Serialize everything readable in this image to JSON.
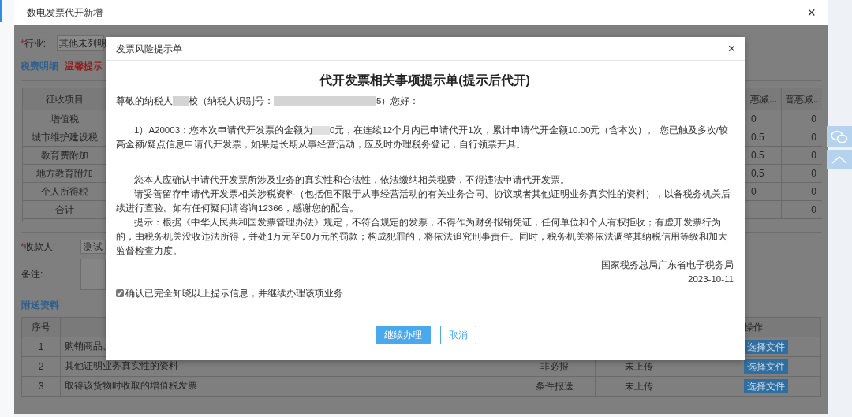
{
  "window": {
    "title": "数电发票代开新增",
    "close": "×"
  },
  "industry": {
    "required_mark": "*",
    "label": "行业:",
    "value": "其他未列明"
  },
  "links": [
    {
      "label": "税费明细",
      "kind": "link"
    },
    {
      "label": "温馨提示",
      "kind": "warning"
    }
  ],
  "tax_table": {
    "column_1": "征收项目",
    "column_a": "惠减...",
    "column_b": "普惠减...",
    "rows": [
      {
        "item": "增值税",
        "column_a": "0",
        "column_b": "0"
      },
      {
        "item": "城市维护建设税",
        "column_a": "0.5",
        "column_b": "0"
      },
      {
        "item": "教育费附加",
        "column_a": "0.5",
        "column_b": "0"
      },
      {
        "item": "地方教育附加",
        "column_a": "0.5",
        "column_b": "0"
      },
      {
        "item": "个人所得税",
        "column_a": "0",
        "column_b": "0"
      },
      {
        "item": "合计",
        "column_b": "0"
      }
    ]
  },
  "payee": {
    "required_mark": "*",
    "label": "收款人:",
    "value": "测试"
  },
  "remark": {
    "label": "备注:"
  },
  "attachments": {
    "title": "附送资料",
    "columns": {
      "number": "序号",
      "action": "操作"
    },
    "rows": [
      {
        "number": "1",
        "name": "购销商品、",
        "button": "选择文件"
      },
      {
        "number": "2",
        "name": "其他证明业务真实性的资料",
        "requirement": "非必报",
        "status": "未上传",
        "button": "选择文件"
      },
      {
        "number": "3",
        "name": "取得该货物时收取的增值税发票",
        "requirement": "条件报送",
        "status": "未上传",
        "button": "选择文件"
      }
    ]
  },
  "dialog": {
    "title": "发票风险提示单",
    "close": "×",
    "heading": "代开发票相关事项提示单(提示后代开)",
    "greeting": [
      "尊敬的纳税人",
      "校（纳税人识别号：",
      "5）您好："
    ],
    "notice": [
      "1）A20003：您本次申请代开发票的金额为",
      "0元，在连续12个月内已申请代开1次，累计申请代开金额10.00元（含本次）。 您已触及多次/较高金额/疑点信息申请代开发票，如果是长期从事经营活动，应及时办理税务登记，自行领票开具。"
    ],
    "paragraphs": [
      "您本人应确认申请代开发票所涉及业务的真实性和合法性，依法缴纳相关税费，不得违法申请代开发票。",
      "请妥善留存申请代开发票相关涉税资料（包括但不限于从事经营活动的有关业务合同、协议或者其他证明业务真实性的资料），以备税务机关后续进行查验。如有任何疑问请咨询12366，感谢您的配合。",
      "提示：根据《中华人民共和国发票管理办法》规定，不符合规定的发票，不得作为财务报销凭证，任何单位和个人有权拒收；有虚开发票行为的，由税务机关没收违法所得，并处1万元至50万元的罚款；构成犯罪的，将依法追究刑事责任。同时，税务机关将依法调整其纳税信用等级和加大监督检查力度。"
    ],
    "signature": "国家税务总局广东省电子税务局",
    "date": "2023-10-11",
    "confirm": {
      "label": "确认已完全知晓以上提示信息，并继续办理该项业务",
      "checked": true
    },
    "buttons": [
      {
        "label": "继续办理",
        "kind": "primary"
      },
      {
        "label": "取消",
        "kind": "secondary"
      }
    ]
  }
}
